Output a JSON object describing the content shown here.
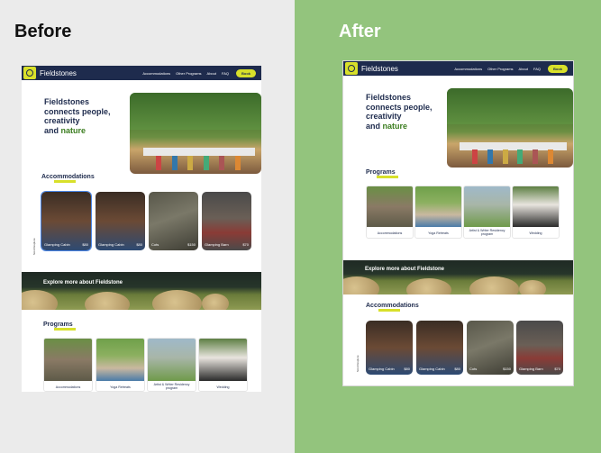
{
  "headings": {
    "before": "Before",
    "after": "After"
  },
  "nav": {
    "brand": "Fieldstones",
    "links": [
      "Accommodations",
      "Other Programs",
      "About",
      "FAQ"
    ],
    "book": "Book"
  },
  "hero": {
    "line1": "Fieldstones",
    "line2": "connects people,",
    "line3": "creativity",
    "line4_prefix": "and ",
    "line4_accent": "nature"
  },
  "accommodations": {
    "title": "Accommodations",
    "side_label": "Scroll Explore",
    "cards": [
      {
        "label": "Glamping Cabin",
        "price": "$80"
      },
      {
        "label": "Glamping Cabin",
        "price": "$80"
      },
      {
        "label": "Cots",
        "price": "$150"
      },
      {
        "label": "Glamping Barn",
        "price": "$70"
      }
    ]
  },
  "banner": {
    "text": "Explore more about Fieldstone"
  },
  "programs": {
    "title": "Programs",
    "cards": [
      {
        "label": "Accommodations"
      },
      {
        "label": "Yoga Retreats"
      },
      {
        "label": "Artist & Writer Residency program"
      },
      {
        "label": "Wedding"
      }
    ]
  },
  "colors": {
    "navy": "#1e2b4d",
    "accent": "#d8e02a",
    "green_bg": "#93c47d",
    "nature_green": "#3b7d1f"
  }
}
